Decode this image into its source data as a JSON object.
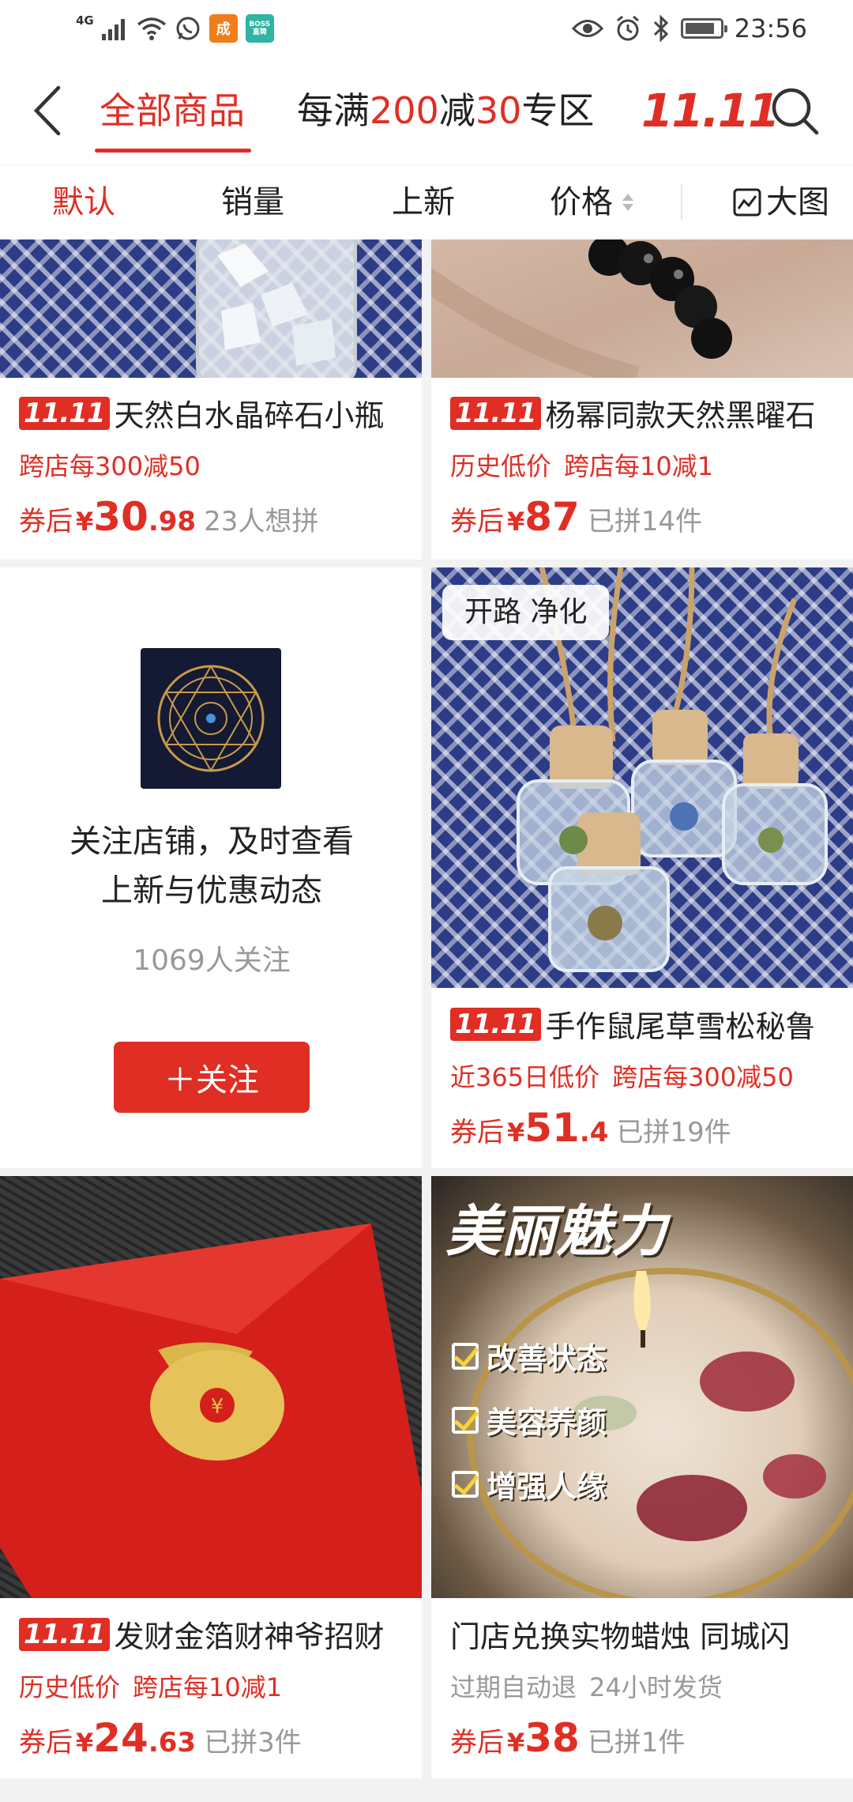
{
  "status_bar": {
    "network_label": "4G",
    "time": "23:56",
    "app_badges": [
      {
        "name": "running-person-app",
        "color": "#f07d1b",
        "glyph": "成"
      },
      {
        "name": "boss-zhipin-app",
        "color": "#2fb3a3",
        "line1": "BOSS",
        "line2": "直聘"
      }
    ]
  },
  "header": {
    "tab_all": "全部商品",
    "promo_prefix": "每满",
    "promo_amount1": "200",
    "promo_mid": "减",
    "promo_amount2": "30",
    "promo_suffix": "专区",
    "event_label": "11.11"
  },
  "sortbar": {
    "default": "默认",
    "sales": "销量",
    "new": "上新",
    "price": "价格",
    "big_view": "大图"
  },
  "products": [
    {
      "badge": "11.11",
      "title": "天然白水晶碎石小瓶",
      "tags": [
        "跨店每300减50"
      ],
      "price_prefix": "券后",
      "currency": "¥",
      "price_int": "30",
      "price_dec": ".98",
      "note": "23人想拼"
    },
    {
      "badge": "11.11",
      "title": "杨幂同款天然黑曜石",
      "tags": [
        "历史低价",
        "跨店每10减1"
      ],
      "price_prefix": "券后",
      "currency": "¥",
      "price_int": "87",
      "price_dec": "",
      "note": "已拼14件"
    },
    {
      "badge": "11.11",
      "image_tag": "开路 净化",
      "title": "手作鼠尾草雪松秘鲁",
      "tags": [
        "近365日低价",
        "跨店每300减50"
      ],
      "price_prefix": "券后",
      "currency": "¥",
      "price_int": "51",
      "price_dec": ".4",
      "note": "已拼19件"
    },
    {
      "badge": "11.11",
      "title": "发财金箔财神爷招财",
      "tags": [
        "历史低价",
        "跨店每10减1"
      ],
      "price_prefix": "券后",
      "currency": "¥",
      "price_int": "24",
      "price_dec": ".63",
      "note": "已拼3件"
    },
    {
      "badge": "",
      "title": "门店兑换实物蜡烛 同城闪",
      "image_headline": "美丽魅力",
      "image_checks": [
        "改善状态",
        "美容养颜",
        "增强人缘"
      ],
      "tags": [
        "过期自动退",
        "24小时发货"
      ],
      "price_prefix": "券后",
      "currency": "¥",
      "price_int": "38",
      "price_dec": "",
      "note": "已拼1件"
    }
  ],
  "store_card": {
    "line1": "关注店铺，及时查看",
    "line2": "上新与优惠动态",
    "followers": "1069人关注",
    "follow_button": "＋关注"
  },
  "colors": {
    "accent": "#e02e24",
    "muted_text": "#999999",
    "background": "#f2f2f2"
  }
}
